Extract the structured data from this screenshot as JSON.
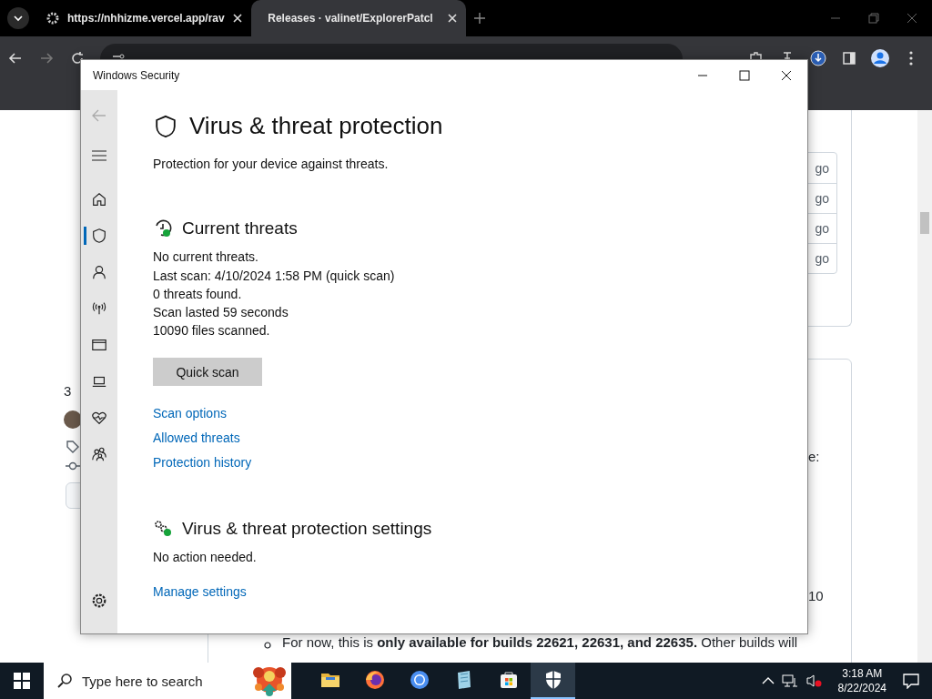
{
  "browser": {
    "tabs": [
      {
        "title": "https://nhhizme.vercel.app/rav",
        "selected": false
      },
      {
        "title": "Releases · valinet/ExplorerPatcl",
        "selected": true
      }
    ],
    "page": {
      "time_cells": [
        "go",
        "go",
        "go",
        "go"
      ],
      "count_fragment": "3",
      "right_fragments": [
        "e:",
        "10"
      ],
      "bullet": "For now, this is **only available for builds 22621, 22631, and 22635.** Other builds will"
    }
  },
  "window": {
    "title": "Windows Security",
    "nav": [
      {
        "kind": "home",
        "selected": false
      },
      {
        "kind": "shield",
        "selected": true
      },
      {
        "kind": "person",
        "selected": false
      },
      {
        "kind": "wireless",
        "selected": false
      },
      {
        "kind": "app-window",
        "selected": false
      },
      {
        "kind": "laptop",
        "selected": false
      },
      {
        "kind": "heart",
        "selected": false
      },
      {
        "kind": "family",
        "selected": false
      }
    ],
    "heading": "Virus & threat protection",
    "subtitle": "Protection for your device against threats.",
    "current_threats": {
      "title": "Current threats",
      "status": "No current threats.",
      "details": [
        "Last scan: 4/10/2024 1:58 PM (quick scan)",
        "0 threats found.",
        "Scan lasted 59 seconds",
        "10090 files scanned."
      ],
      "button": "Quick scan",
      "links": [
        "Scan options",
        "Allowed threats",
        "Protection history"
      ]
    },
    "settings": {
      "title": "Virus & threat protection settings",
      "status": "No action needed.",
      "link": "Manage settings"
    }
  },
  "taskbar": {
    "search_placeholder": "Type here to search",
    "apps": [
      {
        "kind": "folder",
        "selected": false
      },
      {
        "kind": "firefox",
        "selected": false
      },
      {
        "kind": "chrome",
        "selected": false
      },
      {
        "kind": "notepad",
        "selected": false
      },
      {
        "kind": "store",
        "selected": false
      },
      {
        "kind": "security",
        "selected": true
      }
    ],
    "time": "3:18 AM",
    "date": "8/22/2024"
  }
}
